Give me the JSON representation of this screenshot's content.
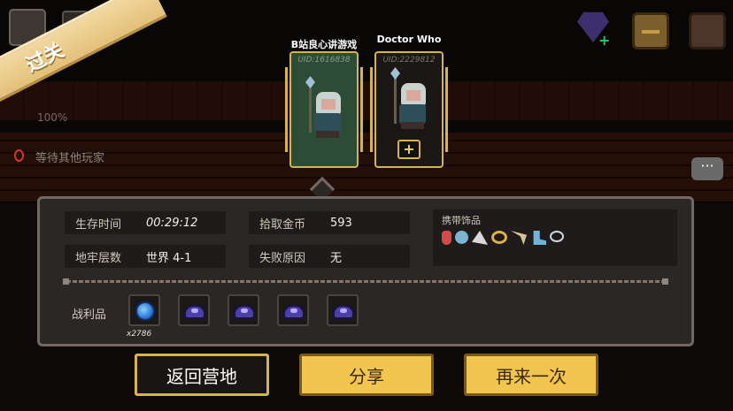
{
  "banner": {
    "label": "过关"
  },
  "players": [
    {
      "name": "B站良心讲游戏",
      "uid": "UID:1616838",
      "state": "active"
    },
    {
      "name": "Doctor Who",
      "uid": "UID:2229812",
      "state": "idle",
      "add_label": "+"
    }
  ],
  "background": {
    "progress_text": "100%",
    "waiting_text": "等待其他玩家",
    "chat_glyph": "···"
  },
  "stats": {
    "survival_time_label": "生存时间",
    "survival_time_value": "00:29:12",
    "dungeon_level_label": "地牢层数",
    "dungeon_level_value": "世界 4-1",
    "gold_label": "拾取金币",
    "gold_value": "593",
    "fail_reason_label": "失败原因",
    "fail_reason_value": "无"
  },
  "accessories": {
    "title": "携带饰品",
    "items": [
      "red-charm-icon",
      "shield-charm-icon",
      "fang-icon",
      "gold-ring-icon",
      "horn-icon",
      "boot-icon",
      "necklace-icon"
    ]
  },
  "loot": {
    "label": "战利品",
    "items": [
      {
        "icon": "blue-gem-coin-icon",
        "count": "x2786"
      },
      {
        "icon": "purple-material-icon"
      },
      {
        "icon": "purple-material-icon"
      },
      {
        "icon": "purple-material-icon"
      },
      {
        "icon": "purple-material-icon"
      }
    ]
  },
  "buttons": {
    "back": "返回营地",
    "share": "分享",
    "again": "再来一次"
  },
  "colors": {
    "gold_accent": "#d7b34e",
    "button_yellow": "#f2c54f",
    "panel_bg": "#2b2725",
    "active_card": "#2d4c36"
  }
}
